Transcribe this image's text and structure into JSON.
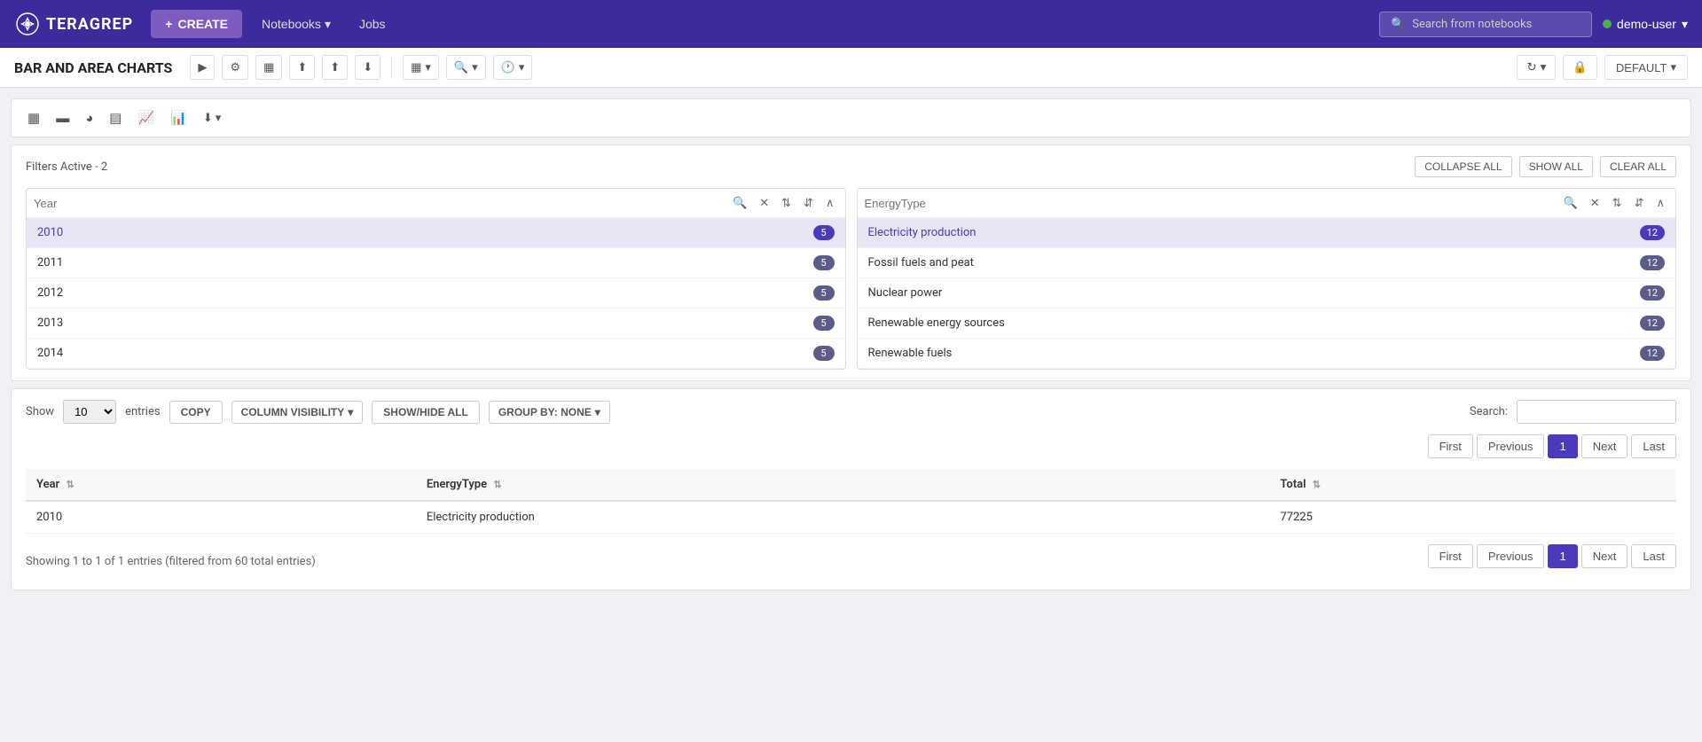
{
  "app": {
    "name": "TERAGREP",
    "logo_symbol": "✦"
  },
  "topnav": {
    "create_label": "CREATE",
    "notebooks_label": "Notebooks",
    "jobs_label": "Jobs",
    "search_placeholder": "Search from notebooks",
    "user_label": "demo-user"
  },
  "toolbar": {
    "page_title": "BAR AND AREA CHARTS",
    "default_label": "DEFAULT"
  },
  "filters": {
    "active_label": "Filters Active - 2",
    "collapse_all": "COLLAPSE ALL",
    "show_all": "SHOW ALL",
    "clear_all": "CLEAR ALL",
    "col1": {
      "placeholder": "Year",
      "items": [
        {
          "label": "2010",
          "count": "5",
          "selected": true
        },
        {
          "label": "2011",
          "count": "5",
          "selected": false
        },
        {
          "label": "2012",
          "count": "5",
          "selected": false
        },
        {
          "label": "2013",
          "count": "5",
          "selected": false
        },
        {
          "label": "2014",
          "count": "5",
          "selected": false
        }
      ]
    },
    "col2": {
      "placeholder": "EnergyType",
      "items": [
        {
          "label": "Electricity production",
          "count": "12",
          "selected": true
        },
        {
          "label": "Fossil fuels and peat",
          "count": "12",
          "selected": false
        },
        {
          "label": "Nuclear power",
          "count": "12",
          "selected": false
        },
        {
          "label": "Renewable energy sources",
          "count": "12",
          "selected": false
        },
        {
          "label": "Renewable fuels",
          "count": "12",
          "selected": false
        }
      ]
    }
  },
  "data_controls": {
    "show_label": "Show",
    "entries_value": "10",
    "entries_label": "entries",
    "copy_label": "COPY",
    "column_visibility_label": "COLUMN VISIBILITY",
    "show_hide_all_label": "SHOW/HIDE ALL",
    "group_by_label": "GROUP BY: NONE",
    "search_label": "Search:"
  },
  "pagination_top": {
    "first": "First",
    "previous": "Previous",
    "current": "1",
    "next": "Next",
    "last": "Last"
  },
  "pagination_bottom": {
    "first": "First",
    "previous": "Previous",
    "current": "1",
    "next": "Next",
    "last": "Last"
  },
  "table": {
    "columns": [
      {
        "label": "Year"
      },
      {
        "label": "EnergyType"
      },
      {
        "label": "Total"
      }
    ],
    "rows": [
      {
        "year": "2010",
        "energy_type": "Electricity production",
        "total": "77225"
      }
    ],
    "footer_info": "Showing 1 to 1 of 1 entries (filtered from 60 total entries)"
  }
}
